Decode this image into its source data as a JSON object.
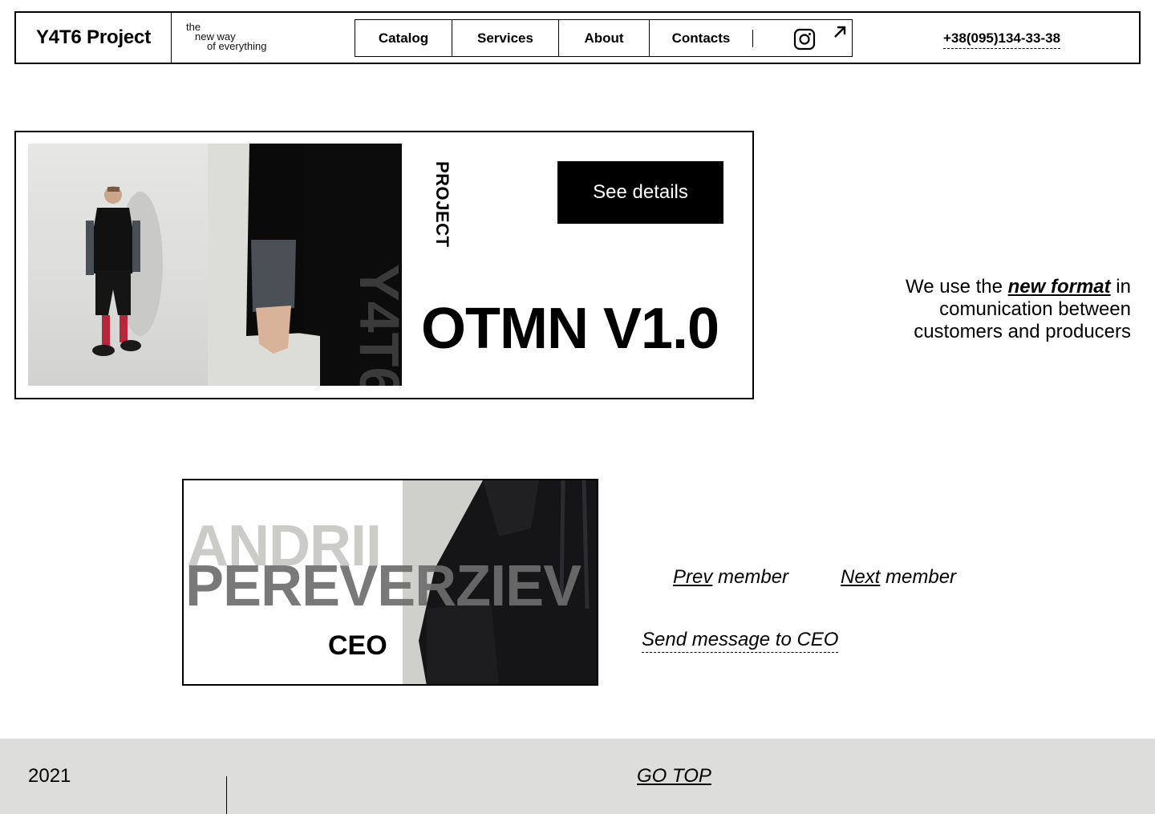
{
  "header": {
    "logo": "Y4T6 Project",
    "tagline": [
      "the",
      "new way",
      "of everything"
    ],
    "nav": [
      "Catalog",
      "Services",
      "About",
      "Contacts"
    ],
    "icons": [
      "instagram-icon",
      "arrow-up-right-icon"
    ],
    "phone": "+38(095)134-33-38"
  },
  "project": {
    "vertical_label": "PROJECT",
    "button": "See details",
    "title": "OTMN V1.0"
  },
  "side_text": {
    "before": "We use the ",
    "emphasis": "new format",
    "after": " in comunication between customers and producers"
  },
  "team": {
    "first_name": "ANDRII",
    "last_name": "PEREVERZIEV",
    "role": "CEO",
    "prev_word": "Prev",
    "next_word": "Next",
    "member_word": "member",
    "send_message": "Send message to CEO"
  },
  "footer": {
    "year": "2021",
    "go_top": "GO TOP"
  },
  "colors": {
    "accent": "#000000",
    "footer_bg": "#dddddb",
    "name_first": "#a0a09b",
    "name_last": "#6e6e6e"
  }
}
